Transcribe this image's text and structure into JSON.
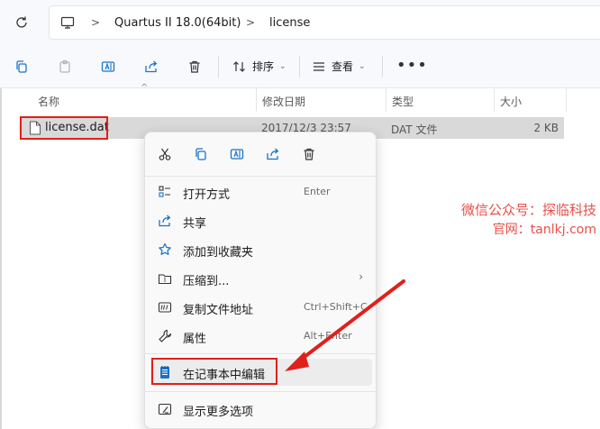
{
  "address": {
    "crumbs": [
      "Quartus II 18.0(64bit)",
      "license"
    ]
  },
  "toolbar": {
    "sort_label": "排序",
    "view_label": "查看",
    "more_label": "•••"
  },
  "columns": {
    "name": "名称",
    "date": "修改日期",
    "type": "类型",
    "size": "大小"
  },
  "file": {
    "name": "license.dat",
    "date": "2017/12/3 23:57",
    "type": "DAT 文件",
    "size": "2 KB"
  },
  "context_menu": {
    "items": [
      {
        "label": "打开方式",
        "shortcut": "Enter",
        "icon": "open-with-icon"
      },
      {
        "label": "共享",
        "shortcut": "",
        "icon": "share-icon"
      },
      {
        "label": "添加到收藏夹",
        "shortcut": "",
        "icon": "star-icon"
      },
      {
        "label": "压缩到...",
        "shortcut": "",
        "icon": "zip-icon"
      },
      {
        "label": "复制文件地址",
        "shortcut": "Ctrl+Shift+C",
        "icon": "copy-path-icon"
      },
      {
        "label": "属性",
        "shortcut": "Alt+Enter",
        "icon": "wrench-icon"
      },
      {
        "label": "在记事本中编辑",
        "shortcut": "",
        "icon": "notepad-icon"
      },
      {
        "label": "显示更多选项",
        "shortcut": "",
        "icon": "more-options-icon"
      }
    ]
  },
  "watermark": {
    "line1": "微信公众号：探临科技",
    "line2": "官网：tanlkj.com"
  },
  "colors": {
    "highlight_red": "#e0201b",
    "accent_blue": "#1a73c8"
  }
}
